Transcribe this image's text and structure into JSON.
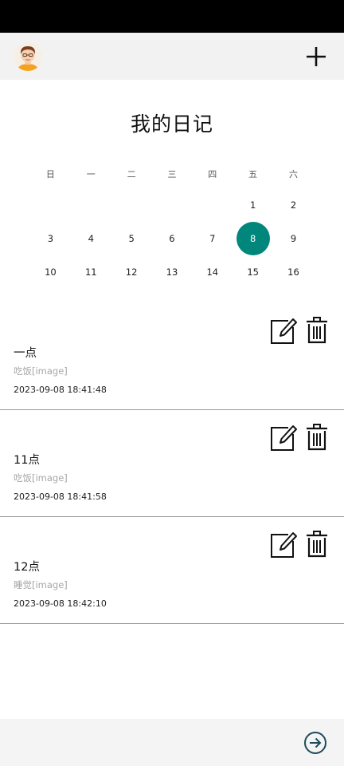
{
  "header": {
    "avatar_icon": "user-avatar",
    "add_icon": "plus-icon"
  },
  "page": {
    "title": "我的日记"
  },
  "calendar": {
    "weekdays": [
      "日",
      "一",
      "二",
      "三",
      "四",
      "五",
      "六"
    ],
    "weeks": [
      [
        "",
        "",
        "",
        "",
        "",
        "1",
        "2"
      ],
      [
        "3",
        "4",
        "5",
        "6",
        "7",
        "8",
        "9"
      ],
      [
        "10",
        "11",
        "12",
        "13",
        "14",
        "15",
        "16"
      ]
    ],
    "selected_day": "8",
    "accent_color": "#00867a"
  },
  "entries": [
    {
      "title": "一点",
      "content": "吃饭[image]",
      "time": "2023-09-08 18:41:48"
    },
    {
      "title": "11点",
      "content": "吃饭[image]",
      "time": "2023-09-08 18:41:58"
    },
    {
      "title": "12点",
      "content": "睡觉[image]",
      "time": "2023-09-08 18:42:10"
    }
  ],
  "icons": {
    "edit": "edit-icon",
    "delete": "trash-icon",
    "next": "arrow-right-circle-icon"
  }
}
